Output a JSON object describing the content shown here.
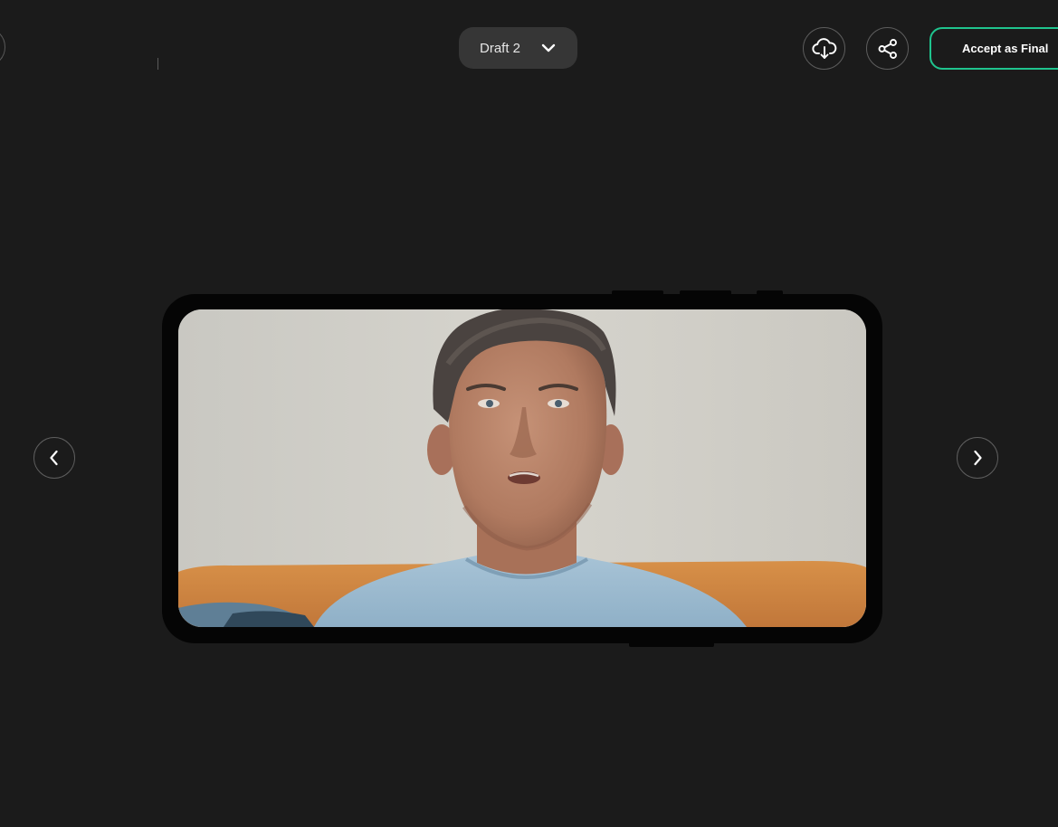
{
  "header": {
    "draft_selector": {
      "selected": "Draft 2"
    },
    "download_icon": "cloud-download-icon",
    "share_icon": "share-icon",
    "accept_label": "Accept as Final"
  },
  "navigation": {
    "prev_icon": "chevron-left-icon",
    "next_icon": "chevron-right-icon"
  },
  "preview": {
    "device": "phone-landscape"
  },
  "colors": {
    "background": "#1b1b1b",
    "accent": "#1fc48e",
    "pill": "#363636"
  }
}
